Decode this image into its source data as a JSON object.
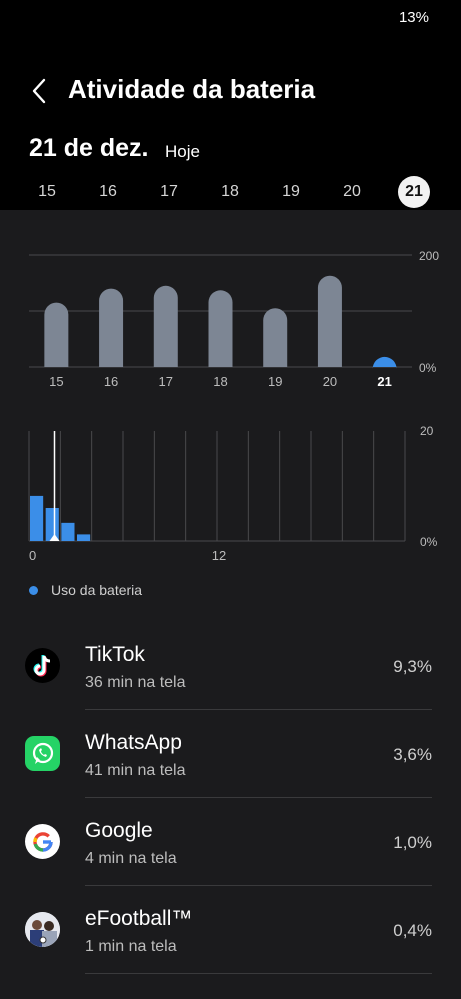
{
  "status_bar": {
    "battery": "13%"
  },
  "header": {
    "title": "Atividade da bateria"
  },
  "date": {
    "main": "21 de dez.",
    "sub": "Hoje"
  },
  "day_selector": {
    "days": [
      "15",
      "16",
      "17",
      "18",
      "19",
      "20",
      "21"
    ],
    "selected": "21"
  },
  "chart_data": [
    {
      "type": "bar",
      "categories": [
        "15",
        "16",
        "17",
        "18",
        "19",
        "20",
        "21"
      ],
      "values": [
        115,
        140,
        145,
        137,
        105,
        163,
        18
      ],
      "ytick_top": "200",
      "ytick_bottom": "0%",
      "ylim": [
        0,
        200
      ],
      "bar_color": "#7d8694",
      "highlight_color": "#3b8ee8",
      "highlight_index": 6
    },
    {
      "type": "bar",
      "xticks": [
        "0",
        "12"
      ],
      "hours": [
        0,
        1,
        2,
        3
      ],
      "values": [
        8.2,
        6,
        3.3,
        1.2
      ],
      "ytick_top": "20",
      "ytick_bottom": "0%",
      "ylim": [
        0,
        20
      ],
      "xlim": [
        0,
        24
      ],
      "current_hour": 1,
      "bar_color": "#3b8ee8"
    }
  ],
  "legend": {
    "label": "Uso da bateria",
    "color": "#3b8ee8"
  },
  "apps": [
    {
      "name": "TikTok",
      "time": "36 min na tela",
      "percent": "9,3%",
      "icon": "tiktok-icon"
    },
    {
      "name": "WhatsApp",
      "time": "41 min na tela",
      "percent": "3,6%",
      "icon": "whatsapp-icon"
    },
    {
      "name": "Google",
      "time": "4 min na tela",
      "percent": "1,0%",
      "icon": "google-icon"
    },
    {
      "name": "eFootball™",
      "time": "1 min na tela",
      "percent": "0,4%",
      "icon": "efootball-icon"
    }
  ]
}
